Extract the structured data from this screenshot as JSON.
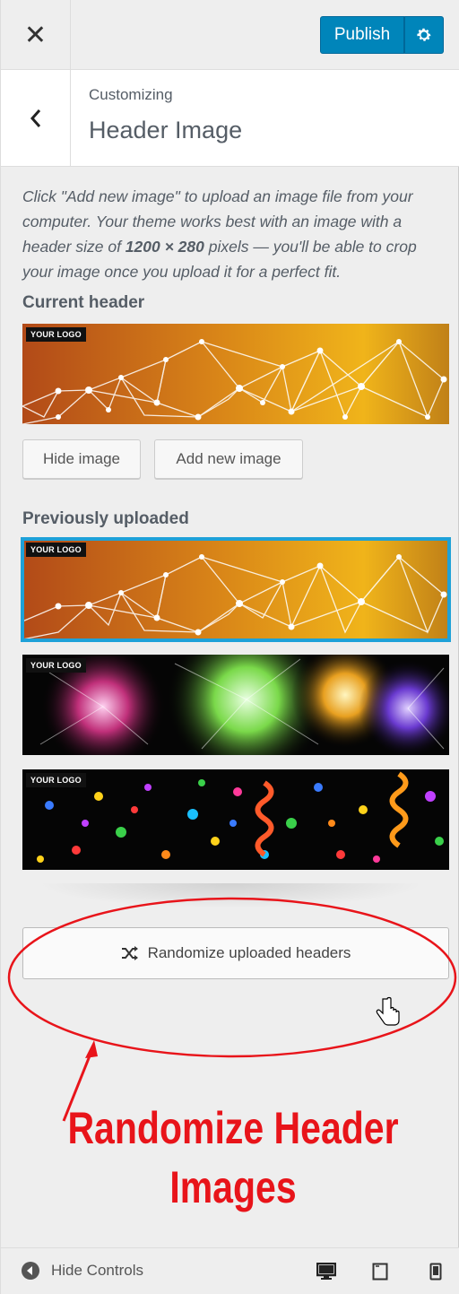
{
  "topbar": {
    "close_icon": "close-icon",
    "publish_label": "Publish",
    "gear_icon": "gear-icon"
  },
  "section": {
    "breadcrumb": "Customizing",
    "title": "Header Image"
  },
  "description": {
    "part1": "Click \"Add new image\" to upload an image file from your computer. Your theme works best with an image with a header size of ",
    "size": "1200 × 280",
    "part2": " pixels — you'll be able to crop your image once you upload it for a perfect fit."
  },
  "current_header": {
    "label": "Current header",
    "logo_text": "YOUR LOGO"
  },
  "buttons": {
    "hide_image": "Hide image",
    "add_new_image": "Add new image"
  },
  "previous": {
    "label": "Previously uploaded",
    "items": [
      {
        "logo_text": "YOUR LOGO",
        "selected": true
      },
      {
        "logo_text": "YOUR LOGO",
        "selected": false
      },
      {
        "logo_text": "YOUR LOGO",
        "selected": false
      }
    ]
  },
  "randomize": {
    "icon": "shuffle-icon",
    "label": "Randomize uploaded headers"
  },
  "callout": {
    "line1": "Randomize Header",
    "line2": "Images",
    "color": "#e8141a"
  },
  "footer": {
    "hide_controls": "Hide Controls",
    "devices": [
      "desktop-icon",
      "tablet-icon",
      "mobile-icon"
    ]
  },
  "colors": {
    "accent": "#0085ba",
    "selected_border": "#1ea1d8"
  }
}
